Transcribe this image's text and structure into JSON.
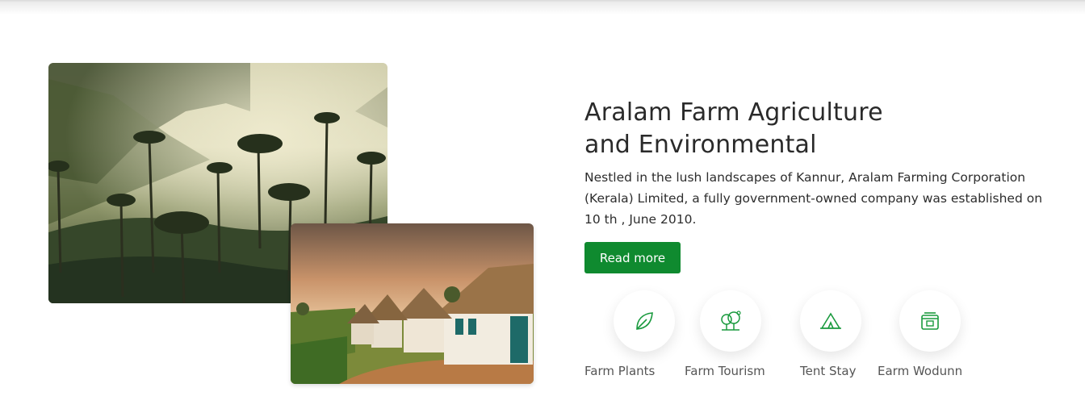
{
  "hero": {
    "title_line1": "Aralam Farm Agriculture",
    "title_line2": "and Environmental",
    "description": "Nestled in the lush landscapes of Kannur, Aralam Farming Corporation (Kerala) Limited, a fully government-owned company was established on 10 th , June 2010.",
    "read_more_label": "Read more",
    "accent_color": "#0f8a2f"
  },
  "features": [
    {
      "label": "Farm Plants",
      "icon": "leaf-icon"
    },
    {
      "label": "Farm Tourism",
      "icon": "trees-icon"
    },
    {
      "label": "Tent Stay",
      "icon": "tent-icon"
    },
    {
      "label": "Earm Wodunn",
      "icon": "store-icon"
    }
  ]
}
